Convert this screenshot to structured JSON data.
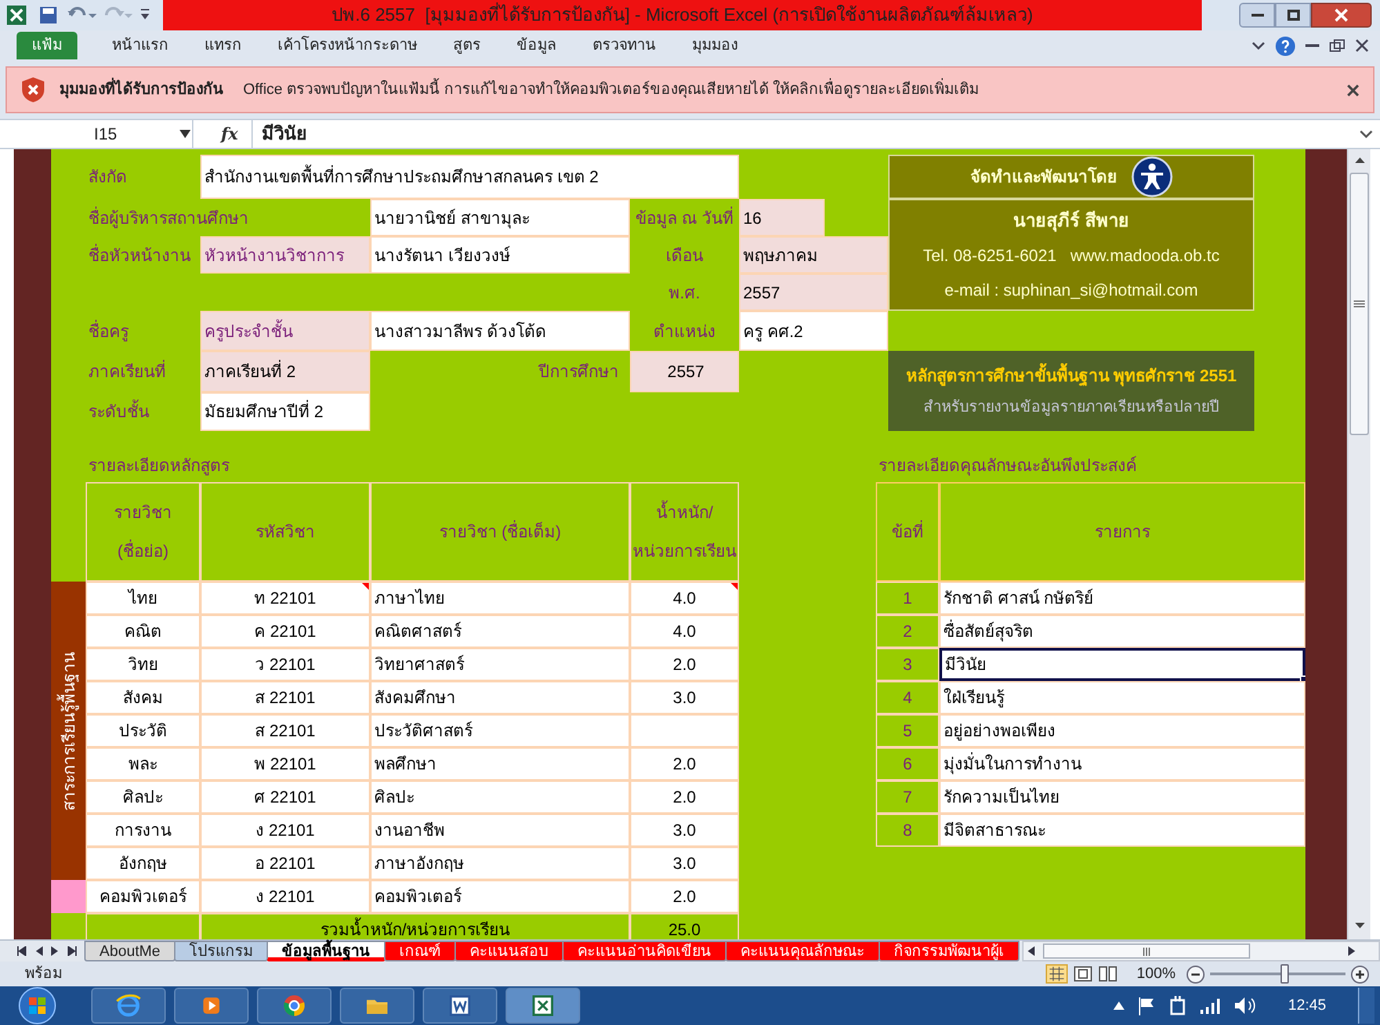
{
  "title_bar": {
    "title": "ปพ.6 2557  [มุมมองที่ได้รับการป้องกัน] - Microsoft Excel (การเปิดใช้งานผลิตภัณฑ์ล้มเหลว)"
  },
  "ribbon_tabs": [
    {
      "label": "แฟ้ม",
      "kind": "file"
    },
    {
      "label": "หน้าแรก",
      "kind": "tab"
    },
    {
      "label": "แทรก",
      "kind": "tab"
    },
    {
      "label": "เค้าโครงหน้ากระดาษ",
      "kind": "tab"
    },
    {
      "label": "สูตร",
      "kind": "tab"
    },
    {
      "label": "ข้อมูล",
      "kind": "tab"
    },
    {
      "label": "ตรวจทาน",
      "kind": "tab"
    },
    {
      "label": "มุมมอง",
      "kind": "tab"
    }
  ],
  "message_bar": {
    "title": "มุมมองที่ได้รับการป้องกัน",
    "message": "Office ตรวจพบปัญหาในแฟ้มนี้ การแก้ไขอาจทำให้คอมพิวเตอร์ของคุณเสียหายได้ ให้คลิกเพื่อดูรายละเอียดเพิ่มเติม"
  },
  "formula_bar": {
    "cell": "I15",
    "function_label": "fx",
    "formula": "มีวินัย"
  },
  "form": {
    "affiliation": {
      "label": "สังกัด",
      "value": "สำนักงานเขตพื้นที่การศึกษาประถมศึกษาสกลนคร เขต 2"
    },
    "director": {
      "label": "ชื่อผู้บริหารสถานศึกษา",
      "value": "นายวานิชย์  สาขามุละ"
    },
    "date": {
      "label": "ข้อมูล ณ วันที่",
      "value": "16"
    },
    "head": {
      "label": "ชื่อหัวหน้างาน",
      "role": "หัวหน้างานวิชาการ",
      "name": "นางรัตนา  เวียงวงษ์"
    },
    "month": {
      "label": "เดือน",
      "value": "พฤษภาคม"
    },
    "year": {
      "label": "พ.ศ.",
      "value": "2557"
    },
    "teacher": {
      "label": "ชื่อครู",
      "role": "ครูประจำชั้น",
      "name": "นางสาวมาลีพร   ด้วงโต้ด"
    },
    "position": {
      "label": "ตำแหน่ง",
      "value": "ครู คศ.2"
    },
    "semester": {
      "label": "ภาคเรียนที่",
      "value": "ภาคเรียนที่ 2"
    },
    "academic_year": {
      "label": "ปีการศึกษา",
      "value": "2557"
    },
    "level": {
      "label": "ระดับชั้น",
      "value": "มัธยมศึกษาปีที่ 2"
    }
  },
  "credits": {
    "heading": "จัดทำและพัฒนาโดย",
    "name": "นายสุภีร์   สีพาย",
    "contact": "Tel. 08-6251-6021   www.madooda.ob.tc",
    "email": "e-mail : suphinan_si@hotmail.com"
  },
  "curriculum_banner": {
    "title": "หลักสูตรการศึกษาขั้นพื้นฐาน พุทธศักราช 2551",
    "subtitle": "สำหรับรายงานข้อมูลรายภาคเรียนหรือปลายปี"
  },
  "course_table": {
    "title": "รายละเอียดหลักสูตร",
    "columns": [
      [
        "รายวิชา",
        "(ชื่อย่อ)"
      ],
      [
        "รหัสวิชา"
      ],
      [
        "รายวิชา (ชื่อเต็ม)"
      ],
      [
        "น้ำหนัก/",
        "หน่วยการเรียน"
      ]
    ],
    "groups": [
      {
        "kind": "basic",
        "label": "สาระการเรียนรู้พื้นฐาน",
        "rows": [
          {
            "short": "ไทย",
            "code": "ท 22101",
            "name": "ภาษาไทย",
            "weight": "4.0",
            "code_note": true,
            "weight_note": true
          },
          {
            "short": "คณิต",
            "code": "ค 22101",
            "name": "คณิตศาสตร์",
            "weight": "4.0",
            "code_note": false,
            "weight_note": false
          },
          {
            "short": "วิทย",
            "code": "ว 22101",
            "name": "วิทยาศาสตร์",
            "weight": "2.0",
            "code_note": false,
            "weight_note": false
          },
          {
            "short": "สังคม",
            "code": "ส 22101",
            "name": "สังคมศึกษา",
            "weight": "3.0",
            "code_note": false,
            "weight_note": false
          },
          {
            "short": "ประวัติ",
            "code": "ส 22101",
            "name": "ประวัติศาสตร์",
            "code_note": false,
            "weight_note": false
          },
          {
            "short": "พละ",
            "code": "พ 22101",
            "name": "พลศึกษา",
            "weight": "2.0",
            "code_note": false,
            "weight_note": false
          },
          {
            "short": "ศิลปะ",
            "code": "ศ 22101",
            "name": "ศิลปะ",
            "weight": "2.0",
            "code_note": false,
            "weight_note": false
          },
          {
            "short": "การงาน",
            "code": "ง 22101",
            "name": "งานอาชีพ",
            "weight": "3.0",
            "code_note": false,
            "weight_note": false
          },
          {
            "short": "อังกฤษ",
            "code": "อ 22101",
            "name": "ภาษาอังกฤษ",
            "weight": "3.0",
            "code_note": false,
            "weight_note": false
          }
        ]
      },
      {
        "kind": "extra",
        "rows": [
          {
            "short": "คอมพิวเตอร์",
            "code": "ง 22101",
            "name": "คอมพิวเตอร์",
            "weight": "2.0",
            "code_note": false,
            "weight_note": false
          }
        ]
      }
    ],
    "total": {
      "label": "รวมน้ำหนัก/หน่วยการเรียน",
      "value": "25.0"
    }
  },
  "traits_table": {
    "title": "รายละเอียดคุณลักษณะอันพึงประสงค์",
    "columns": [
      "ข้อที่",
      "รายการ"
    ],
    "rows": [
      {
        "no": "1",
        "text": "รักชาติ ศาสน์ กษัตริย์",
        "selected": false
      },
      {
        "no": "2",
        "text": "ซื่อสัตย์สุจริต",
        "selected": false
      },
      {
        "no": "3",
        "text": "มีวินัย",
        "selected": true
      },
      {
        "no": "4",
        "text": "ใฝ่เรียนรู้",
        "selected": false
      },
      {
        "no": "5",
        "text": "อยู่อย่างพอเพียง",
        "selected": false
      },
      {
        "no": "6",
        "text": "มุ่งมั่นในการทำงาน",
        "selected": false
      },
      {
        "no": "7",
        "text": "รักความเป็นไทย",
        "selected": false
      },
      {
        "no": "8",
        "text": "มีจิตสาธารณะ",
        "selected": false
      }
    ]
  },
  "sheet_tabs": [
    {
      "label": "AboutMe",
      "selected": false,
      "color": "#d9d9d9"
    },
    {
      "label": "โปรแกรม",
      "selected": false,
      "color": "#b8cce4"
    },
    {
      "label": "ข้อมูลพื้นฐาน",
      "selected": true,
      "color": "#ff0000"
    },
    {
      "label": "เกณฑ์",
      "selected": false,
      "color": "#ff0000"
    },
    {
      "label": "คะแนนสอบ",
      "selected": false,
      "color": "#ff0000"
    },
    {
      "label": "คะแนนอ่านคิดเขียน",
      "selected": false,
      "color": "#ff0000"
    },
    {
      "label": "คะแนนคุณลักษณะ",
      "selected": false,
      "color": "#ff0000"
    },
    {
      "label": "กิจกรรมพัฒนาผู้เ",
      "selected": false,
      "color": "#ff0000"
    }
  ],
  "status_bar": {
    "status": "พร้อม",
    "zoom": "100%",
    "level": 0.55
  },
  "taskbar": {
    "clock": "12:45"
  }
}
